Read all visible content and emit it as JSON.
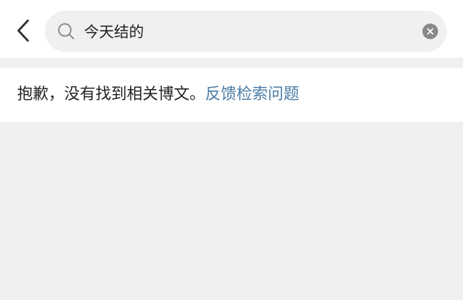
{
  "header": {
    "back_icon": "chevron-left-icon",
    "search": {
      "icon": "search-icon",
      "value": "今天结的",
      "clear_icon": "clear-icon"
    }
  },
  "result": {
    "message": "抱歉，没有找到相关博文。",
    "feedback_link": "反馈检索问题"
  },
  "colors": {
    "link": "#4a7ca6",
    "background": "#f0f0f0",
    "panel": "#ffffff"
  }
}
